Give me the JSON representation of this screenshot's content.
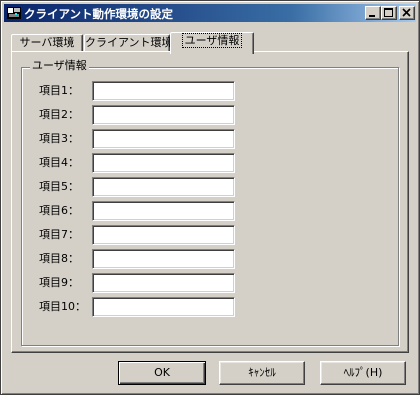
{
  "window": {
    "title": "クライアント動作環境の設定"
  },
  "tabs": [
    {
      "label": "サーバ環境",
      "active": false
    },
    {
      "label": "クライアント環境",
      "active": false
    },
    {
      "label": "ユーザ情報",
      "active": true
    }
  ],
  "group": {
    "label": "ユーザ情報",
    "fields": [
      {
        "label": "項目1：",
        "value": ""
      },
      {
        "label": "項目2：",
        "value": ""
      },
      {
        "label": "項目3：",
        "value": ""
      },
      {
        "label": "項目4：",
        "value": ""
      },
      {
        "label": "項目5：",
        "value": ""
      },
      {
        "label": "項目6：",
        "value": ""
      },
      {
        "label": "項目7：",
        "value": ""
      },
      {
        "label": "項目8：",
        "value": ""
      },
      {
        "label": "項目9：",
        "value": ""
      },
      {
        "label": "項目10：",
        "value": ""
      }
    ]
  },
  "buttons": {
    "ok": "OK",
    "cancel": "ｷｬﾝｾﾙ",
    "help": "ﾍﾙﾌﾟ(H)"
  },
  "icons": {
    "app": "app-icon",
    "minimize": "minimize-icon",
    "maximize": "maximize-icon",
    "close": "close-icon"
  },
  "colors": {
    "titlebar_start": "#0a246a",
    "titlebar_end": "#a6caf0",
    "face": "#d4d0c8"
  }
}
